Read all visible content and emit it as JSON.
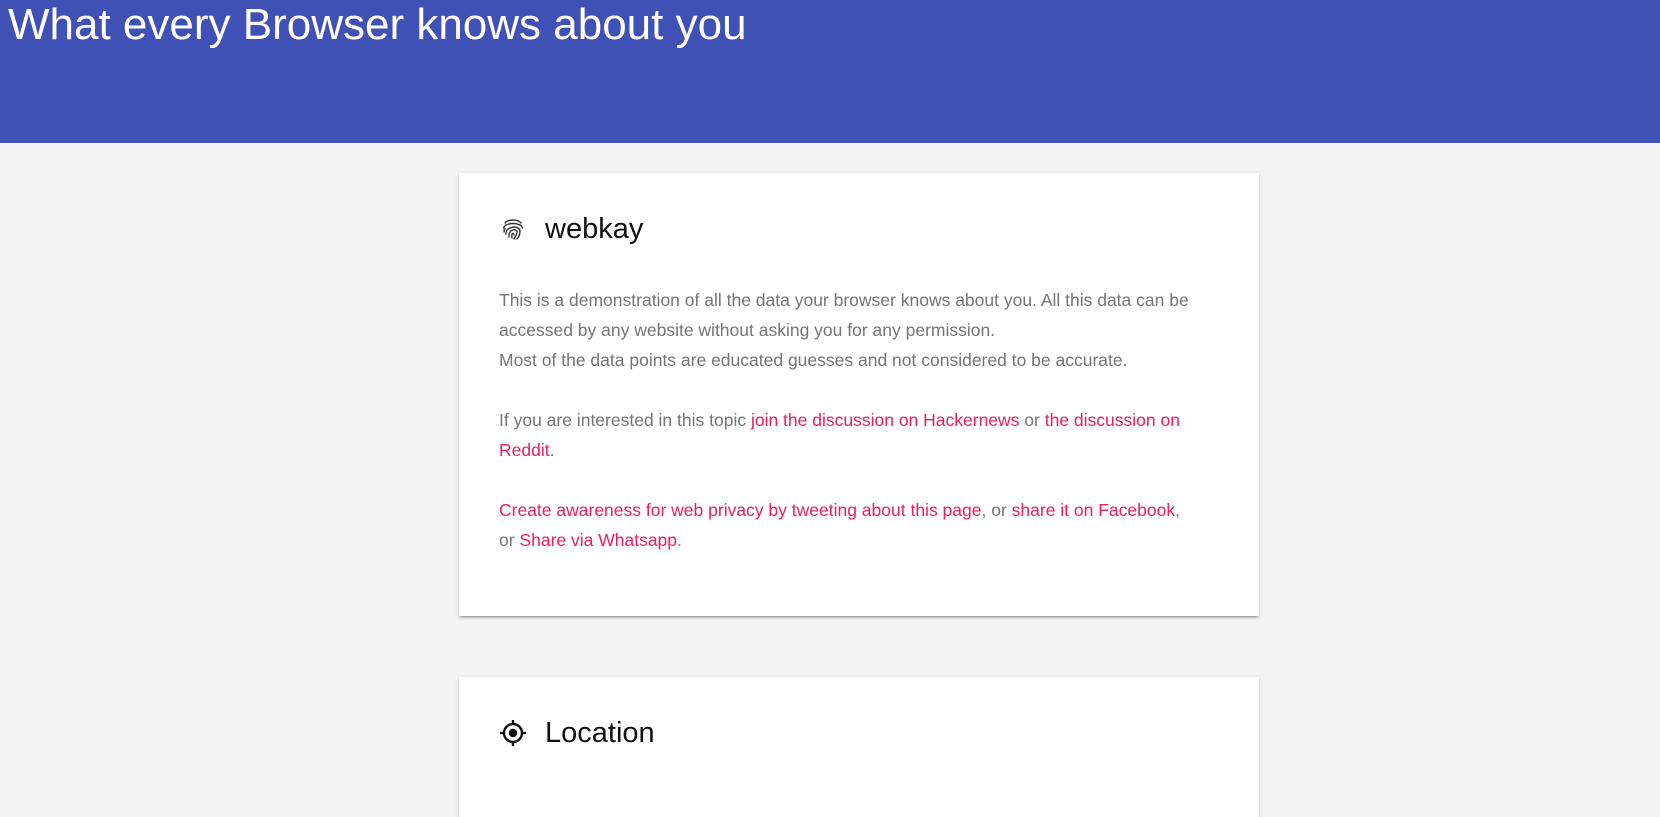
{
  "header": {
    "title": "What every Browser knows about you"
  },
  "intro_card": {
    "title": "webkay",
    "icon": "fingerprint-icon",
    "paragraph1": {
      "line1": "This is a demonstration of all the data your browser knows about you. All this data can be accessed by any website without asking you for any permission.",
      "line2": "Most of the data points are educated guesses and not considered to be accurate."
    },
    "paragraph2": {
      "text_before": "If you are interested in this topic ",
      "link_hackernews": "join the discussion on Hackernews",
      "text_middle": " or ",
      "link_reddit": "the discussion on Reddit",
      "text_after": "."
    },
    "paragraph3": {
      "link_tweet": "Create awareness for web privacy by tweeting about this page",
      "sep1": ", or ",
      "link_facebook": "share it on Facebook",
      "sep2": ", or ",
      "link_whatsapp": "Share via Whatsapp",
      "text_after": "."
    }
  },
  "location_card": {
    "title": "Location",
    "icon": "gps-crosshair-icon"
  },
  "colors": {
    "header_bg": "#3f51b5",
    "page_bg": "#f4f4f4",
    "link": "#e91e63",
    "body_text": "#757575"
  }
}
